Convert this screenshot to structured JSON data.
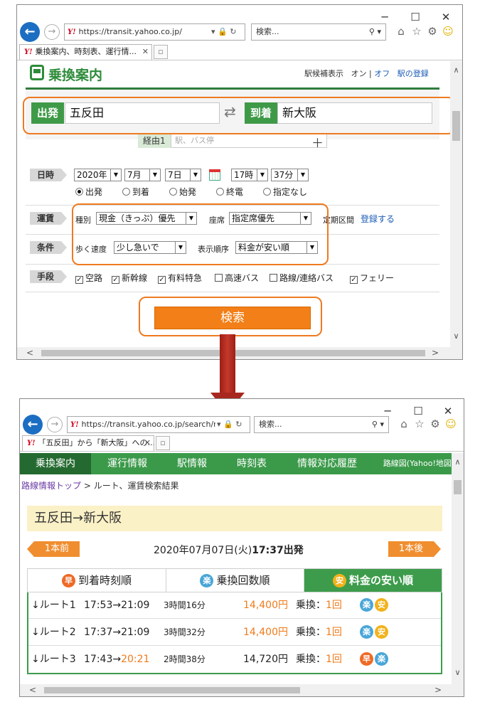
{
  "browser1": {
    "url": "https://transit.yahoo.co.jp/",
    "search_placeholder": "検索...",
    "tab_title": "乗換案内、時刻表、運行情...",
    "fav_logo": "Y!"
  },
  "page1": {
    "logo_text": "乗換案内",
    "top_right": {
      "suggest_label": "駅候補表示",
      "on_label": "オン",
      "divider": "|",
      "off_label": "オフ",
      "register_stations": "駅の登録"
    },
    "departure": {
      "label": "出発",
      "value": "五反田"
    },
    "arrival": {
      "label": "到着",
      "value": "新大阪"
    },
    "via": {
      "label": "経由1",
      "placeholder": "駅、バス停"
    },
    "datetime": {
      "label": "日時",
      "year": "2020年",
      "month": "7月",
      "day": "7日",
      "hour": "17時",
      "minute": "37分",
      "options": [
        "出発",
        "到着",
        "始発",
        "終電",
        "指定なし"
      ],
      "selected_index": 0
    },
    "fare": {
      "label": "運賃",
      "type_label": "種別",
      "type_value": "現金（きっぷ）優先",
      "seat_label": "座席",
      "seat_value": "指定席優先",
      "commuter_label": "定期区間",
      "register_link": "登録する"
    },
    "conditions": {
      "label": "条件",
      "speed_label": "歩く速度",
      "speed_value": "少し急いで",
      "order_label": "表示順序",
      "order_value": "料金が安い順"
    },
    "means": {
      "label": "手段",
      "options": [
        {
          "label": "空路",
          "checked": true
        },
        {
          "label": "新幹線",
          "checked": true
        },
        {
          "label": "有料特急",
          "checked": true
        },
        {
          "label": "高速バス",
          "checked": false
        },
        {
          "label": "路線/連絡バス",
          "checked": false
        },
        {
          "label": "フェリー",
          "checked": true
        }
      ]
    },
    "search_button": "検索"
  },
  "browser2": {
    "url": "https://transit.yahoo.co.jp/search/r",
    "search_placeholder": "検索...",
    "tab_title": "「五反田」から「新大阪」への...",
    "fav_logo": "Y!"
  },
  "page2": {
    "nav": [
      "乗換案内",
      "運行情報",
      "駅情報",
      "時刻表",
      "情報対応履歴",
      "路線図(Yahoo!地図)"
    ],
    "breadcrumb_link": "路線情報トップ",
    "breadcrumb_rest": " > ルート、運賃検索結果",
    "route_title": "五反田→新大阪",
    "prev_label": "1本前",
    "next_label": "1本後",
    "search_date": "2020年07月07日(火)",
    "search_time": "17:37出発",
    "sort_tabs": [
      {
        "badge": "早",
        "label": "到着時刻順"
      },
      {
        "badge": "楽",
        "label": "乗換回数順"
      },
      {
        "badge": "安",
        "label": "料金の安い順"
      }
    ],
    "routes": [
      {
        "name": "↓ルート1",
        "dep": "17:53",
        "arrow": "→",
        "arr": "21:09",
        "duration": "3時間16分",
        "fare": "14,400円",
        "transfer_label": "乗換：",
        "transfers": "1回",
        "badges": [
          "楽",
          "安"
        ]
      },
      {
        "name": "↓ルート2",
        "dep": "17:37",
        "arrow": "→",
        "arr": "21:09",
        "duration": "3時間32分",
        "fare": "14,400円",
        "transfer_label": "乗換：",
        "transfers": "1回",
        "badges": [
          "楽",
          "安"
        ]
      },
      {
        "name": "↓ルート3",
        "dep": "17:43",
        "arrow": "→",
        "arr": "20:21",
        "duration": "2時間38分",
        "fare": "14,720円",
        "transfer_label": "乗換：",
        "transfers": "1回",
        "badges": [
          "早",
          "楽"
        ]
      }
    ]
  },
  "colors": {
    "brand_green": "#3b9a4a",
    "dark_green": "#246a30",
    "highlight_orange": "#ee7a20",
    "button_orange": "#f27f17",
    "arrow_red": "#a7281e"
  }
}
